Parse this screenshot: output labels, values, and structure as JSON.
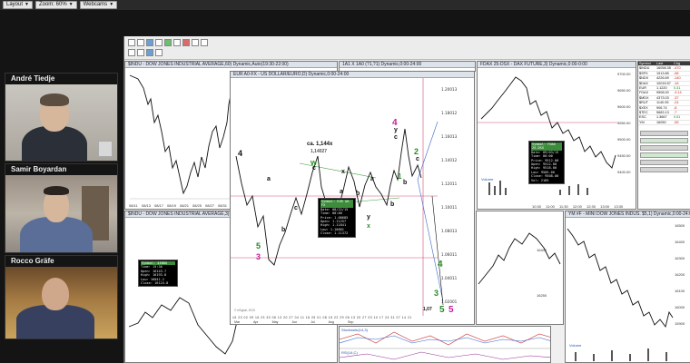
{
  "toolbar": {
    "layout_label": "Layout",
    "zoom_label": "Zoom: 60%",
    "webcams_label": "Webcams"
  },
  "participants": [
    {
      "name": "André Tiedje"
    },
    {
      "name": "Samir Boyardan"
    },
    {
      "name": "Rocco Gräfe"
    }
  ],
  "windows": {
    "dow_daily": {
      "title": "$INDU - DOW JONES INDUSTRIAL AVERAGE,60) Dynamic,Auto(19:30-22:00)"
    },
    "dow_lower": {
      "title": "$INDU - DOW JONES INDUSTRIAL AVERAGE,3) Dynamic"
    },
    "eurusd": {
      "title": "EUR A0-FX - US DOLLAR/EURO,D) Dynamic,0:00-24:00"
    },
    "dax_mid": {
      "title": "1A1 X 1A0 (?1,?1) Dynamic,0:00-24:00"
    },
    "dax": {
      "title": "FDAX 25-DSX - DAX FUTURE,3) Dynamic,0:00-0:00"
    },
    "mini_dow": {
      "title": "YM #F - MINI DOW JONES INDUS. $5,1) Dynamic,0:00-24:00"
    }
  },
  "dow_top": {
    "price_labels": [
      "17000",
      "16500",
      "16000"
    ],
    "date_labels": [
      "08/11",
      "08/13",
      "08/17",
      "08/19",
      "08/21",
      "08/25",
      "08/27",
      "08/31"
    ]
  },
  "dow_bottom": {
    "info_box": {
      "header": "Symbol: $INDU",
      "lines": [
        "Time: 15:30",
        "Open: 16143.7",
        "High: 16193.8",
        "Low: 16041.2",
        "Close: 16124.8"
      ]
    },
    "price_labels": [
      "16400",
      "16250"
    ],
    "oscillator_labels": [
      "Stochastic(14,3)",
      "RSI(14,C)"
    ]
  },
  "eurusd": {
    "price_labels": [
      "1.20013",
      "1.18012",
      "1.16013",
      "1.14012",
      "1.12011",
      "1.10011",
      "1.08013",
      "1.06011",
      "1.04011",
      "1.02001"
    ],
    "date_labels": [
      "16",
      "23",
      "02",
      "09",
      "16",
      "23",
      "30",
      "06",
      "13",
      "20",
      "27",
      "04",
      "11",
      "18",
      "25",
      "01",
      "08",
      "15",
      "22",
      "29",
      "06",
      "13",
      "20",
      "27",
      "03",
      "10",
      "17",
      "24",
      "31",
      "07",
      "14",
      "21"
    ],
    "month_labels": [
      "Mar",
      "Apr",
      "May",
      "Jun",
      "Jul",
      "Aug",
      "Sep"
    ],
    "fib_label": "ca. 1,144x",
    "fib_value": "1,14027",
    "wave_labels": {
      "w": "w",
      "x_top": "x",
      "y_top": "y",
      "c_top": "c",
      "four_top": "4",
      "two": "2",
      "one": "1",
      "a1": "a",
      "b1": "b",
      "c1": "c",
      "a2": "a",
      "b2": "b",
      "c2": "c",
      "four_left": "4",
      "five_left": "5",
      "three_left": "3",
      "y_low": "y",
      "x_low": "x",
      "four_green": "4",
      "three_green": "3",
      "five_target": "5",
      "five_violet": "5",
      "a3": "a",
      "b3": "b",
      "c3": "c"
    },
    "mid_info": {
      "header": "Symbol: EUR A0-FX",
      "lines": [
        "Date: 08/22/15",
        "Time: 00:00",
        "Price: 1.08685",
        "Open: 1.11257",
        "High: 1.11841",
        "Low: 1.10801",
        "Close: 1.11372"
      ]
    },
    "low_price_label": "1,07",
    "footer_note": "© eSignal, 2015"
  },
  "dax": {
    "price_labels": [
      "9700.00",
      "9650.00",
      "9600.00",
      "9550.00",
      "9500.00",
      "9450.00",
      "9400.00"
    ],
    "time_labels": [
      "10:30",
      "11:00",
      "11:30",
      "12:00",
      "12:30",
      "13:00",
      "13:30"
    ],
    "info_box": {
      "header": "Symbol: FDAX 25-DSX",
      "lines": [
        "Date: 09/03/15",
        "Time: 00:00",
        "Price: 9512.00",
        "Open: 9512.00",
        "High: 9518.00",
        "Low: 9505.00",
        "Close: 9508.00",
        "Vol: 2185"
      ]
    },
    "volume_label": "Volume"
  },
  "quote_table": {
    "headers": [
      "Symbol",
      "Last",
      "Chg"
    ],
    "rows": [
      [
        "$INDU",
        "16058.35",
        "-470"
      ],
      [
        "$SPX",
        "1913.85",
        "-58"
      ],
      [
        "$NDX",
        "4226.69",
        "-140"
      ],
      [
        "$DAX",
        "10015.57",
        "-16"
      ],
      [
        "EUR",
        "1.1220",
        "0.31"
      ],
      [
        "FDAX",
        "9508.00",
        "-3.14"
      ],
      [
        "$MDX",
        "4373.03",
        "-37"
      ],
      [
        "$RUT",
        "1140.05",
        "-24"
      ],
      [
        "$XEX",
        "906.74",
        "-8"
      ],
      [
        "$TEC",
        "5683.13",
        "-7"
      ],
      [
        "ESC",
        "1.3667",
        "0.51"
      ],
      [
        "YM",
        "16050",
        "-55"
      ]
    ]
  },
  "mini_dow": {
    "price_labels": [
      "16500",
      "16400",
      "16300",
      "16200",
      "16100",
      "16000",
      "15900"
    ],
    "volume_label": "Volume"
  }
}
